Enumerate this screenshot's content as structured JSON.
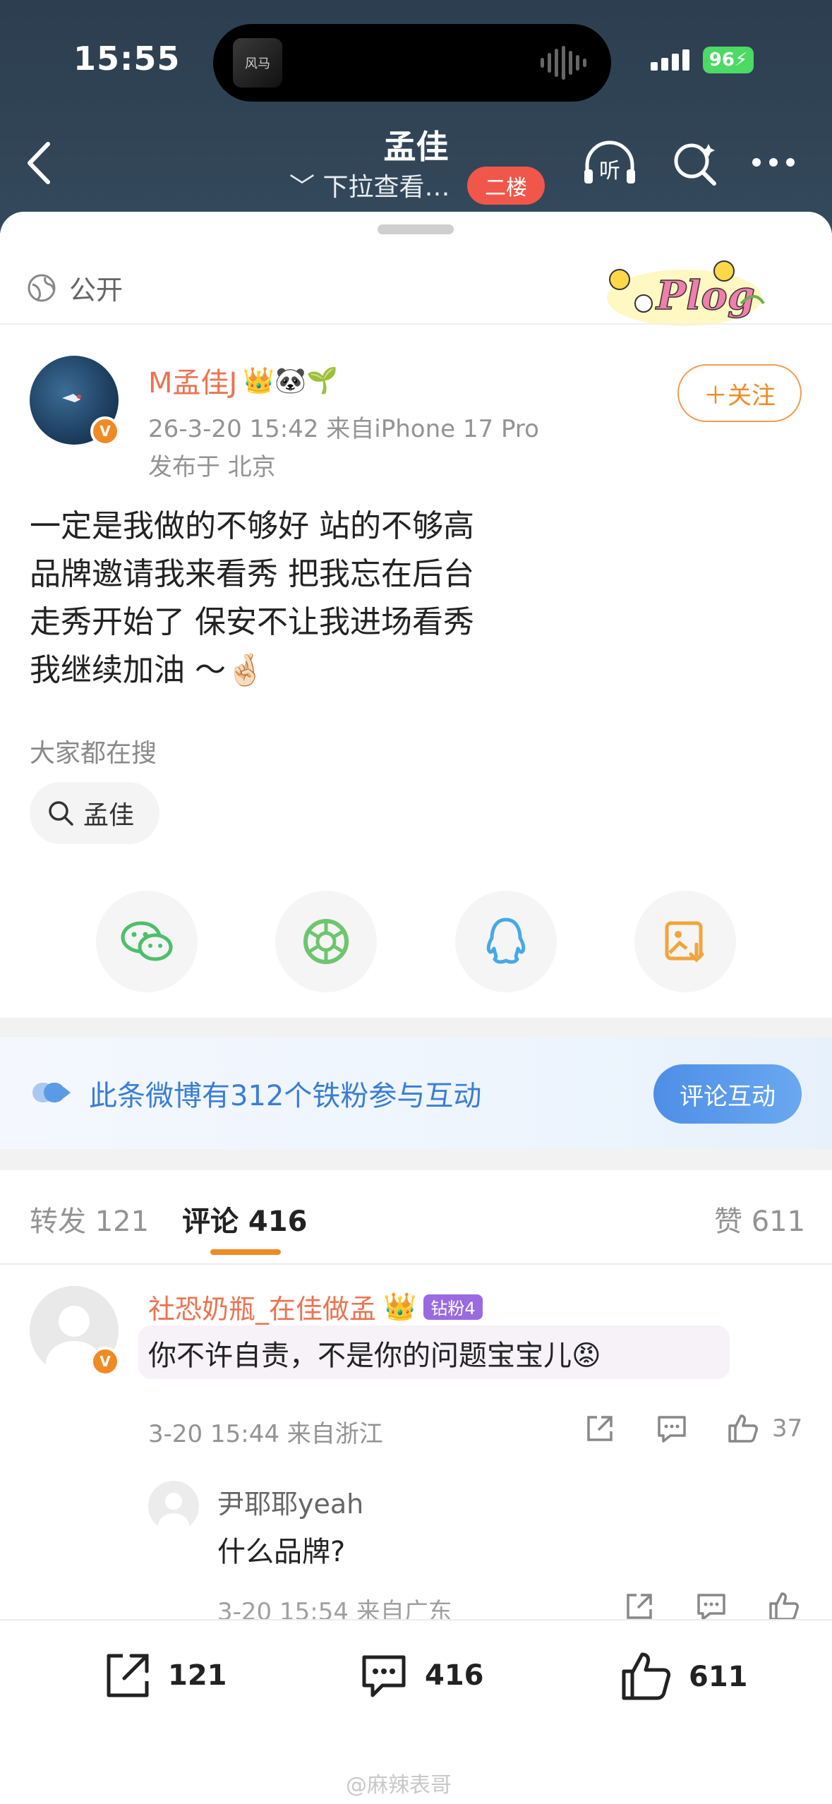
{
  "status": {
    "time": "15:55",
    "battery": "96"
  },
  "island": {
    "thumb_text": "风马"
  },
  "nav": {
    "title": "孟佳",
    "subtitle": "﹀ 下拉查看…",
    "floor_badge": "二楼",
    "listen_label": "听"
  },
  "post": {
    "visibility": "公开",
    "plog_label": "Plog",
    "user_name": "M孟佳J",
    "user_emojis": "👑🐼🌱",
    "meta": "26-3-20 15:42  来自iPhone 17 Pro",
    "location": "发布于 北京",
    "follow_label": "＋关注",
    "text_lines": [
      "一定是我做的不够好 站的不够高",
      "品牌邀请我来看秀 把我忘在后台",
      "走秀开始了 保安不让我进场看秀",
      "我继续加油 ～🤞🏻"
    ],
    "search_label": "大家都在搜",
    "search_chip": "孟佳"
  },
  "fans_banner": {
    "text": "此条微博有312个铁粉参与互动",
    "button": "评论互动"
  },
  "tabs": {
    "repost": "转发 121",
    "comment": "评论 416",
    "like": "赞 611"
  },
  "comment": {
    "name": "社恐奶瓶_在佳做孟",
    "crown": "👑",
    "fan_badge": "钻粉4",
    "text": "你不许自责，不是你的问题宝宝儿😡",
    "meta": "3-20 15:44  来自浙江",
    "likes": "37"
  },
  "reply": {
    "name": "尹耶耶yeah",
    "text": "什么品牌?",
    "meta": "3-20 15:54  来自广东"
  },
  "bottom_bar": {
    "repost": "121",
    "comment": "416",
    "like": "611",
    "watermark": "@麻辣表哥"
  },
  "colors": {
    "orange": "#f08a24",
    "name_orange": "#eb7350",
    "blue": "#3a7dd6",
    "header": "#2c3e4f"
  }
}
